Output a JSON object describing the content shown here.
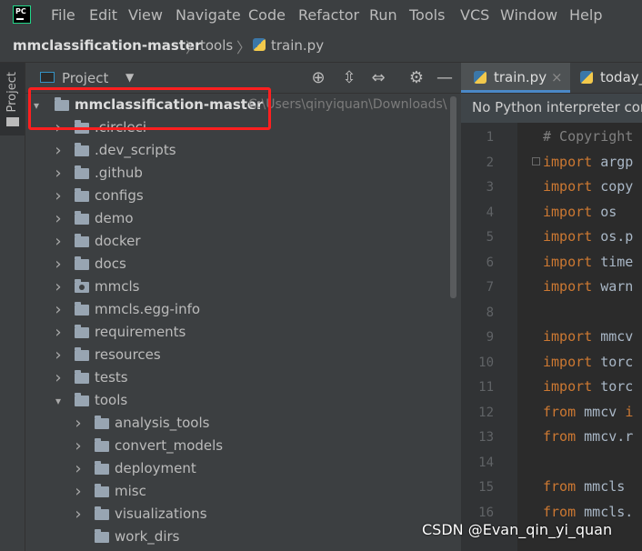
{
  "menu": {
    "items": [
      "File",
      "Edit",
      "View",
      "Navigate",
      "Code",
      "Refactor",
      "Run",
      "Tools",
      "VCS",
      "Window",
      "Help"
    ]
  },
  "breadcrumb": {
    "project": "mmclassification-master",
    "folder": "tools",
    "file": "train.py"
  },
  "toolstrip": {
    "project_label": "Project"
  },
  "panel": {
    "title": "Project",
    "icons": [
      "locate-icon",
      "expand-all-icon",
      "collapse-all-icon",
      "gear-icon",
      "minimize-icon"
    ]
  },
  "tree": {
    "root": {
      "name": "mmclassification-master",
      "path": "C:\\Users\\qinyiquan\\Downloads\\"
    },
    "items": [
      {
        "name": ".circleci",
        "depth": 1,
        "expanded": false
      },
      {
        "name": ".dev_scripts",
        "depth": 1,
        "expanded": false
      },
      {
        "name": ".github",
        "depth": 1,
        "expanded": false
      },
      {
        "name": "configs",
        "depth": 1,
        "expanded": false
      },
      {
        "name": "demo",
        "depth": 1,
        "expanded": false
      },
      {
        "name": "docker",
        "depth": 1,
        "expanded": false
      },
      {
        "name": "docs",
        "depth": 1,
        "expanded": false
      },
      {
        "name": "mmcls",
        "depth": 1,
        "expanded": false,
        "module": true
      },
      {
        "name": "mmcls.egg-info",
        "depth": 1,
        "expanded": false
      },
      {
        "name": "requirements",
        "depth": 1,
        "expanded": false
      },
      {
        "name": "resources",
        "depth": 1,
        "expanded": false
      },
      {
        "name": "tests",
        "depth": 1,
        "expanded": false
      },
      {
        "name": "tools",
        "depth": 1,
        "expanded": true
      },
      {
        "name": "analysis_tools",
        "depth": 2,
        "expanded": false
      },
      {
        "name": "convert_models",
        "depth": 2,
        "expanded": false
      },
      {
        "name": "deployment",
        "depth": 2,
        "expanded": false
      },
      {
        "name": "misc",
        "depth": 2,
        "expanded": false
      },
      {
        "name": "visualizations",
        "depth": 2,
        "expanded": false
      },
      {
        "name": "work_dirs",
        "depth": 2,
        "expanded": false,
        "no_arrow": true
      }
    ]
  },
  "editor": {
    "tabs": [
      {
        "label": "train.py",
        "active": true,
        "close": "×"
      },
      {
        "label": "today_",
        "active": false
      }
    ],
    "notice": "No Python interpreter cor",
    "lines": [
      {
        "n": "1",
        "parts": [
          [
            "cm",
            "# Copyright"
          ]
        ]
      },
      {
        "n": "2",
        "parts": [
          [
            "kw",
            "import "
          ],
          [
            "txt",
            "argp"
          ]
        ]
      },
      {
        "n": "3",
        "parts": [
          [
            "kw",
            "import "
          ],
          [
            "txt",
            "copy"
          ]
        ]
      },
      {
        "n": "4",
        "parts": [
          [
            "kw",
            "import "
          ],
          [
            "txt",
            "os"
          ]
        ]
      },
      {
        "n": "5",
        "parts": [
          [
            "kw",
            "import "
          ],
          [
            "txt",
            "os.p"
          ]
        ]
      },
      {
        "n": "6",
        "parts": [
          [
            "kw",
            "import "
          ],
          [
            "txt",
            "time"
          ]
        ]
      },
      {
        "n": "7",
        "parts": [
          [
            "kw",
            "import "
          ],
          [
            "txt",
            "warn"
          ]
        ]
      },
      {
        "n": "8",
        "parts": []
      },
      {
        "n": "9",
        "parts": [
          [
            "kw",
            "import "
          ],
          [
            "txt",
            "mmcv"
          ]
        ]
      },
      {
        "n": "10",
        "parts": [
          [
            "kw",
            "import "
          ],
          [
            "txt",
            "torc"
          ]
        ]
      },
      {
        "n": "11",
        "parts": [
          [
            "kw",
            "import "
          ],
          [
            "txt",
            "torc"
          ]
        ]
      },
      {
        "n": "12",
        "parts": [
          [
            "kw",
            "from "
          ],
          [
            "txt",
            "mmcv "
          ],
          [
            "kw",
            "i"
          ]
        ]
      },
      {
        "n": "13",
        "parts": [
          [
            "kw",
            "from "
          ],
          [
            "txt",
            "mmcv.r"
          ]
        ]
      },
      {
        "n": "14",
        "parts": []
      },
      {
        "n": "15",
        "parts": [
          [
            "kw",
            "from "
          ],
          [
            "txt",
            "mmcls"
          ]
        ]
      },
      {
        "n": "16",
        "parts": [
          [
            "kw",
            "from "
          ],
          [
            "txt",
            "mmcls."
          ]
        ]
      }
    ]
  },
  "watermark": "CSDN @Evan_qin_yi_quan"
}
